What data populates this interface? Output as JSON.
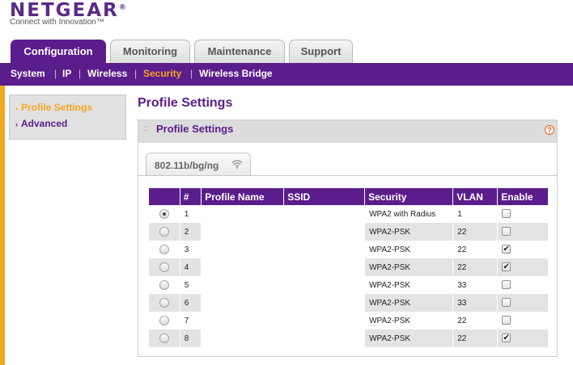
{
  "brand": {
    "logo": "NETGEAR",
    "logo_mark": "®",
    "tagline": "Connect with Innovation™"
  },
  "tabs": [
    {
      "label": "Configuration",
      "active": true
    },
    {
      "label": "Monitoring",
      "active": false
    },
    {
      "label": "Maintenance",
      "active": false
    },
    {
      "label": "Support",
      "active": false
    }
  ],
  "subnav": {
    "items": [
      {
        "label": "System",
        "active": false
      },
      {
        "label": "IP",
        "active": false
      },
      {
        "label": "Wireless",
        "active": false
      },
      {
        "label": "Security",
        "active": true
      },
      {
        "label": "Wireless Bridge",
        "active": false
      }
    ],
    "separator": "|"
  },
  "sidemenu": {
    "items": [
      {
        "label": "Profile Settings",
        "active": true,
        "icon": "chevron-right-icon"
      },
      {
        "label": "Advanced",
        "active": false,
        "icon": "chevron-right-icon"
      }
    ]
  },
  "page": {
    "title": "Profile Settings"
  },
  "panel": {
    "title": "Profile Settings",
    "help_symbol": "?",
    "band_tab": {
      "label": "802.11b/bg/ng",
      "icon": "wifi-icon"
    },
    "table": {
      "headers": [
        "",
        "#",
        "Profile Name",
        "SSID",
        "Security",
        "VLAN",
        "Enable"
      ],
      "rows": [
        {
          "selected": true,
          "num": "1",
          "profile_name": "",
          "ssid": "",
          "security": "WPA2 with Radius",
          "vlan": "1",
          "enabled": false
        },
        {
          "selected": false,
          "num": "2",
          "profile_name": "",
          "ssid": "",
          "security": "WPA2-PSK",
          "vlan": "22",
          "enabled": false
        },
        {
          "selected": false,
          "num": "3",
          "profile_name": "",
          "ssid": "",
          "security": "WPA2-PSK",
          "vlan": "22",
          "enabled": true
        },
        {
          "selected": false,
          "num": "4",
          "profile_name": "",
          "ssid": "",
          "security": "WPA2-PSK",
          "vlan": "22",
          "enabled": true
        },
        {
          "selected": false,
          "num": "5",
          "profile_name": "",
          "ssid": "",
          "security": "WPA2-PSK",
          "vlan": "33",
          "enabled": false
        },
        {
          "selected": false,
          "num": "6",
          "profile_name": "",
          "ssid": "",
          "security": "WPA2-PSK",
          "vlan": "33",
          "enabled": false
        },
        {
          "selected": false,
          "num": "7",
          "profile_name": "",
          "ssid": "",
          "security": "WPA2-PSK",
          "vlan": "22",
          "enabled": false
        },
        {
          "selected": false,
          "num": "8",
          "profile_name": "",
          "ssid": "",
          "security": "WPA2-PSK",
          "vlan": "22",
          "enabled": true
        }
      ]
    }
  },
  "colors": {
    "brand_purple": "#5b1d8c",
    "accent_orange": "#f5a623",
    "help_orange": "#e85d0d"
  }
}
